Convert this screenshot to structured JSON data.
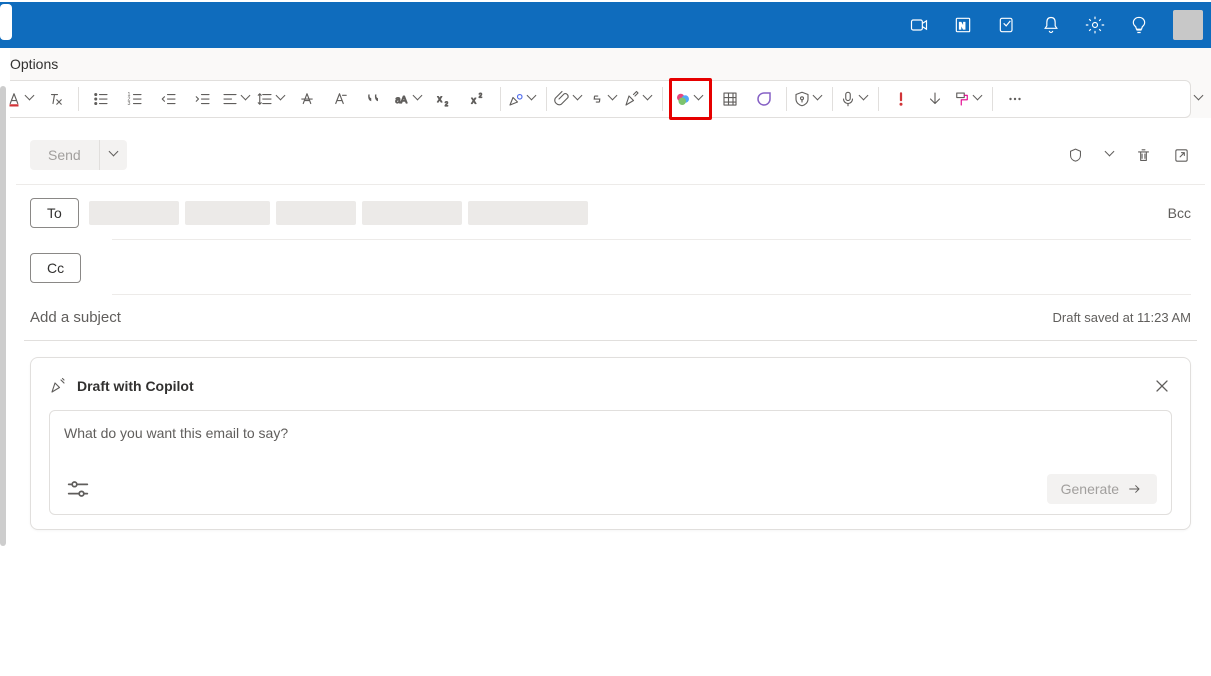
{
  "titlebar": {
    "icons": [
      "meet",
      "onenote",
      "notes",
      "bell",
      "settings",
      "lightbulb"
    ]
  },
  "ribbon": {
    "tab_options": "Options"
  },
  "compose": {
    "send_label": "Send",
    "to_label": "To",
    "cc_label": "Cc",
    "bcc_label": "Bcc",
    "subject_placeholder": "Add a subject",
    "saved_status": "Draft saved at 11:23 AM"
  },
  "copilot": {
    "title": "Draft with Copilot",
    "prompt_placeholder": "What do you want this email to say?",
    "generate_label": "Generate"
  },
  "colors": {
    "brand": "#0F6CBD",
    "font_red": "#d13438"
  }
}
